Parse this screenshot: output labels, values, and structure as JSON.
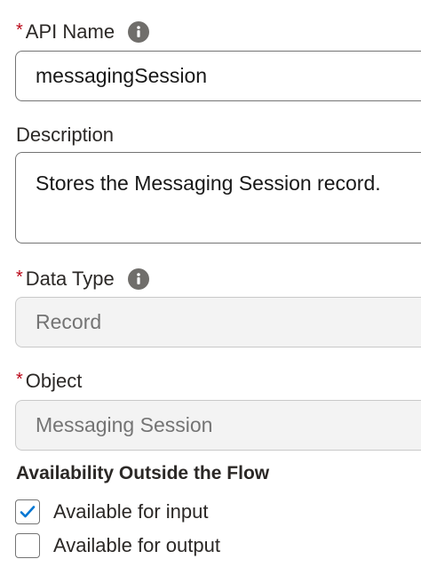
{
  "fields": {
    "api_name": {
      "label": "API Name",
      "required_marker": "*",
      "value": "messagingSession",
      "info_icon": "info-icon"
    },
    "description": {
      "label": "Description",
      "value": "Stores the Messaging Session record."
    },
    "data_type": {
      "label": "Data Type",
      "required_marker": "*",
      "value": "Record",
      "info_icon": "info-icon"
    },
    "object": {
      "label": "Object",
      "required_marker": "*",
      "value": "Messaging Session"
    }
  },
  "availability": {
    "title": "Availability Outside the Flow",
    "input": {
      "label": "Available for input",
      "checked": true
    },
    "output": {
      "label": "Available for output",
      "checked": false
    }
  },
  "colors": {
    "required": "#ba0517",
    "checkmark": "#0176d3",
    "info_icon": "#706e6b"
  }
}
